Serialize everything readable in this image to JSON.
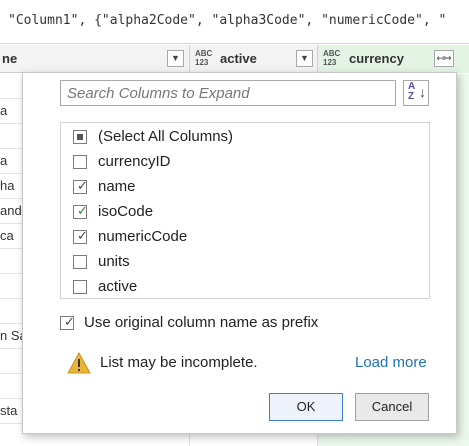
{
  "formula_bar": {
    "text": "\"Column1\", {\"alpha2Code\", \"alpha3Code\", \"numericCode\", \""
  },
  "headers": {
    "first": {
      "partial_title": "ne",
      "dropdown_glyph": "▼"
    },
    "active": {
      "type_top": "ABC",
      "type_bottom": "123",
      "title": "active",
      "dropdown_glyph": "▼"
    },
    "currency": {
      "type_top": "ABC",
      "type_bottom": "123",
      "title": "currency",
      "expand_glyph": "↤↦"
    }
  },
  "grid_rows": [
    {
      "text": ""
    },
    {
      "text": "a"
    },
    {
      "text": ""
    },
    {
      "text": "a"
    },
    {
      "text": "ha"
    },
    {
      "text": "and"
    },
    {
      "text": "ca"
    },
    {
      "text": ""
    },
    {
      "text": ""
    },
    {
      "text": ""
    },
    {
      "text": "n Sa"
    },
    {
      "text": ""
    },
    {
      "text": ""
    },
    {
      "text": "sta"
    },
    {
      "text": ""
    }
  ],
  "popup": {
    "search_placeholder": "Search Columns to Expand",
    "sort_icon_label": "A Z",
    "items": [
      {
        "label": "(Select All Columns)",
        "state": "partial"
      },
      {
        "label": "currencyID",
        "state": "unchecked"
      },
      {
        "label": "name",
        "state": "checked"
      },
      {
        "label": "isoCode",
        "state": "checked"
      },
      {
        "label": "numericCode",
        "state": "checked"
      },
      {
        "label": "units",
        "state": "unchecked"
      },
      {
        "label": "active",
        "state": "unchecked"
      }
    ],
    "prefix_label": "Use original column name as prefix",
    "prefix_checked": true,
    "warning_text": "List may be incomplete.",
    "load_more_label": "Load more",
    "ok_label": "OK",
    "cancel_label": "Cancel"
  },
  "colors": {
    "accent_green": "#2e8b3a",
    "link_blue": "#1e73b5",
    "warning_yellow": "#e8b53a",
    "currency_column_bg": "#e4f4e4"
  }
}
